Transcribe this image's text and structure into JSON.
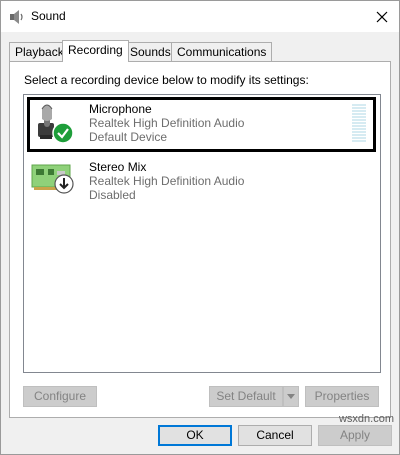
{
  "window": {
    "title": "Sound",
    "title_icon": "speaker-icon",
    "close_icon": "close-icon"
  },
  "tabs": [
    {
      "label": "Playback",
      "active": false
    },
    {
      "label": "Recording",
      "active": true
    },
    {
      "label": "Sounds",
      "active": false
    },
    {
      "label": "Communications",
      "active": false
    }
  ],
  "instruction": "Select a recording device below to modify its settings:",
  "devices": [
    {
      "name": "Microphone",
      "driver": "Realtek High Definition Audio",
      "status": "Default Device",
      "status_icon": "check-circle-icon",
      "device_icon": "microphone-icon",
      "selected": true
    },
    {
      "name": "Stereo Mix",
      "driver": "Realtek High Definition Audio",
      "status": "Disabled",
      "status_icon": "down-arrow-circle-icon",
      "device_icon": "sound-card-icon",
      "selected": false
    }
  ],
  "panel_buttons": {
    "configure": "Configure",
    "set_default": "Set Default",
    "properties": "Properties"
  },
  "dialog_buttons": {
    "ok": "OK",
    "cancel": "Cancel",
    "apply": "Apply"
  },
  "watermark": "wsxdn.com",
  "colors": {
    "accent": "#0078d7",
    "check_green": "#1e9e3a",
    "disabled_text": "#838383",
    "meter": "#d6ebf2"
  }
}
